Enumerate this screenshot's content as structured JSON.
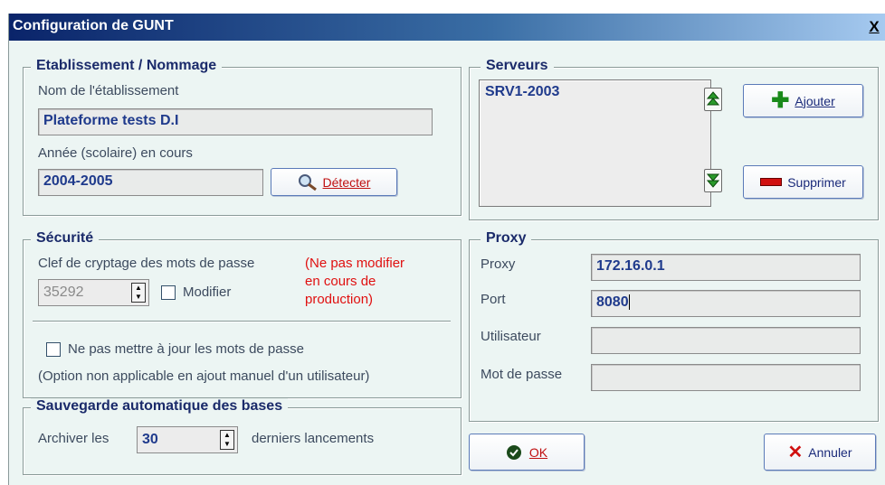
{
  "window": {
    "title": "Configuration de GUNT",
    "close_label": "X"
  },
  "etablissement": {
    "legend": "Etablissement / Nommage",
    "nom_label": "Nom de l'établissement",
    "nom_value": "Plateforme tests D.I",
    "annee_label": "Année (scolaire) en cours",
    "annee_value": "2004-2005",
    "detecter_label": "Détecter"
  },
  "securite": {
    "legend": "Sécurité",
    "clef_label": "Clef de cryptage des mots de passe",
    "warning": [
      "(Ne pas modifier",
      "en cours de",
      "production)"
    ],
    "clef_value": "35292",
    "modifier_label": "Modifier",
    "nepas_label": "Ne pas mettre à jour les mots de passe",
    "note": "(Option non applicable  en ajout manuel d'un utilisateur)"
  },
  "sauvegarde": {
    "legend": "Sauvegarde automatique des bases",
    "archiver_label": "Archiver les",
    "archiver_value": "30",
    "derniers_label": "derniers lancements"
  },
  "serveurs": {
    "legend": "Serveurs",
    "items": [
      "SRV1-2003"
    ],
    "ajouter_label": "Ajouter",
    "supprimer_label": "Supprimer"
  },
  "proxy": {
    "legend": "Proxy",
    "proxy_label": "Proxy",
    "proxy_value": "172.16.0.1",
    "port_label": "Port",
    "port_value": "8080",
    "utilisateur_label": "Utilisateur",
    "utilisateur_value": "",
    "motdepasse_label": "Mot de passe",
    "motdepasse_value": ""
  },
  "buttons": {
    "ok_label": "OK",
    "annuler_label": "Annuler"
  },
  "colors": {
    "accent": "#1f3a8c",
    "warning": "#e01010",
    "ok_green": "#2a6a1a",
    "add_green": "#1a8a1a",
    "delete_red": "#d01010"
  }
}
